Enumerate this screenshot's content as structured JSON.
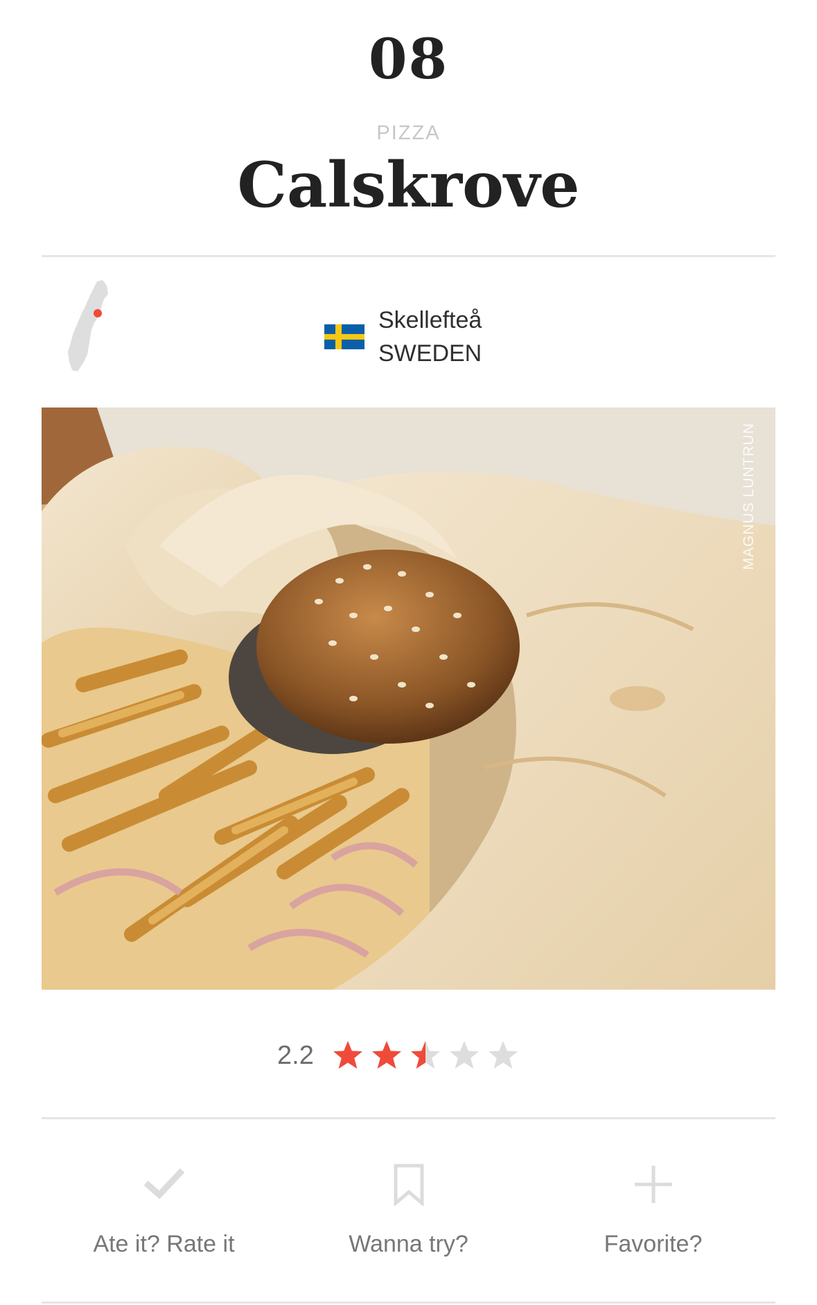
{
  "header": {
    "rank": "08",
    "category": "PIZZA",
    "title": "Calskrove"
  },
  "location": {
    "city": "Skellefteå",
    "country": "SWEDEN",
    "flag_icon": "sweden-flag-icon",
    "map_icon": "sweden-map-icon"
  },
  "photo": {
    "credit": "MAGNUS LUNTRUN"
  },
  "rating": {
    "value": "2.2",
    "stars_filled": 2.5,
    "stars_total": 5,
    "star_color": "#f04a3a",
    "star_empty_color": "#dddddd"
  },
  "actions": [
    {
      "label": "Ate it? Rate it",
      "icon": "check-icon"
    },
    {
      "label": "Wanna try?",
      "icon": "bookmark-icon"
    },
    {
      "label": "Favorite?",
      "icon": "plus-icon"
    }
  ],
  "colors": {
    "accent": "#f04a3a",
    "divider": "#e5e5e5",
    "muted_text": "#777777"
  }
}
